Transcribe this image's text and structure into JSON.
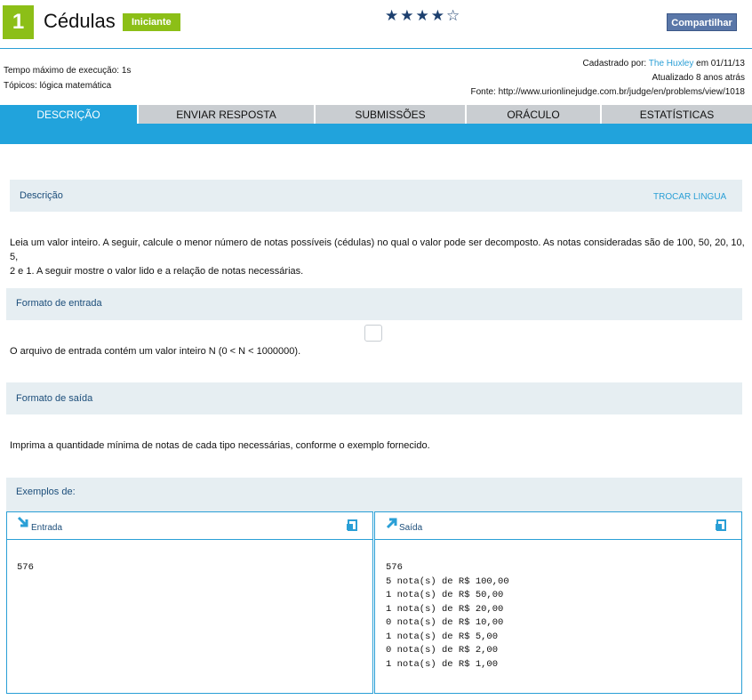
{
  "problem": {
    "number": "1",
    "title": "Cédulas",
    "level": "Iniciante",
    "stars": "★★★★☆",
    "share_label": "Compartilhar"
  },
  "meta": {
    "time_limit": "Tempo máximo de execução: 1s",
    "topics": "Tópicos: lógica matemática",
    "registered_prefix": "Cadastrado por: ",
    "registered_user": "The Huxley",
    "registered_suffix": " em 01/11/13",
    "updated": "Atualizado 8 anos atrás",
    "source": "Fonte: http://www.urionlinejudge.com.br/judge/en/problems/view/1018"
  },
  "tabs": [
    "DESCRIÇÃO",
    "ENVIAR RESPOSTA",
    "SUBMISSÕES",
    "ORÁCULO",
    "ESTATÍSTICAS"
  ],
  "description": {
    "title": "Descrição",
    "switch_language": "TROCAR LINGUA",
    "line1": "Leia um valor inteiro. A seguir, calcule o menor número de notas possíveis (cédulas) no qual o valor pode ser decomposto. As notas consideradas são de 100, 50, 20, 10, 5,",
    "line2": "2 e 1. A seguir mostre o valor lido e a relação de notas necessárias."
  },
  "input_format": {
    "title": "Formato de entrada",
    "text": "O arquivo de entrada contém um valor inteiro N (0 < N < 1000000)."
  },
  "output_format": {
    "title": "Formato de saída",
    "text": "Imprima a quantidade mínima de notas de cada tipo necessárias, conforme o exemplo fornecido."
  },
  "examples": {
    "title": "Exemplos de:",
    "input_label": "Entrada",
    "output_label": "Saída",
    "input_text": "576",
    "output_text": "576\n5 nota(s) de R$ 100,00\n1 nota(s) de R$ 50,00\n1 nota(s) de R$ 20,00\n0 nota(s) de R$ 10,00\n1 nota(s) de R$ 5,00\n0 nota(s) de R$ 2,00\n1 nota(s) de R$ 1,00"
  },
  "colors": {
    "accent_blue": "#21a3dc",
    "level_green": "#8cbf17",
    "heading_blue": "#1b4d7a"
  }
}
